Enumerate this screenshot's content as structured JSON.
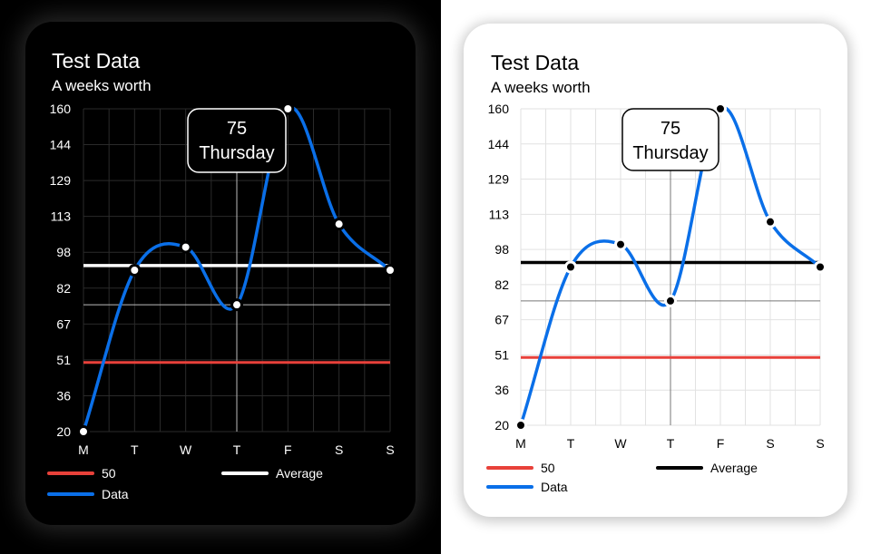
{
  "chart_data": {
    "type": "line",
    "title": "Test Data",
    "subtitle": "A weeks worth",
    "categories": [
      "M",
      "T",
      "W",
      "T",
      "F",
      "S",
      "S"
    ],
    "y_ticks": [
      "160",
      "144",
      "129",
      "113",
      "98",
      "82",
      "67",
      "51",
      "36",
      "20"
    ],
    "ylim": [
      20,
      160
    ],
    "series": [
      {
        "name": "Data",
        "values": [
          20,
          90,
          100,
          75,
          160,
          110,
          90
        ]
      }
    ],
    "reference_lines": [
      {
        "name": "50",
        "value": 50
      },
      {
        "name": "Average",
        "value": 92
      }
    ],
    "tooltip": {
      "value": "75",
      "label": "Thursday",
      "index": 3
    },
    "grid": true,
    "legend": "bottom",
    "colors": {
      "data": "#0a6fe8",
      "fifty": "#e8413a"
    }
  },
  "themes": [
    {
      "name": "dark",
      "average_color": "#ffffff",
      "text": "#ffffff",
      "grid": "#2a2a2a",
      "crosshair": "#bbbbbb",
      "tooltip_bg": "#000000",
      "tooltip_border": "#ffffff",
      "point_fill": "#ffffff",
      "point_stroke": "#000000"
    },
    {
      "name": "light",
      "average_color": "#000000",
      "text": "#000000",
      "grid": "#e2e2e2",
      "crosshair": "#777777",
      "tooltip_bg": "#ffffff",
      "tooltip_border": "#000000",
      "point_fill": "#000000",
      "point_stroke": "#ffffff"
    }
  ]
}
